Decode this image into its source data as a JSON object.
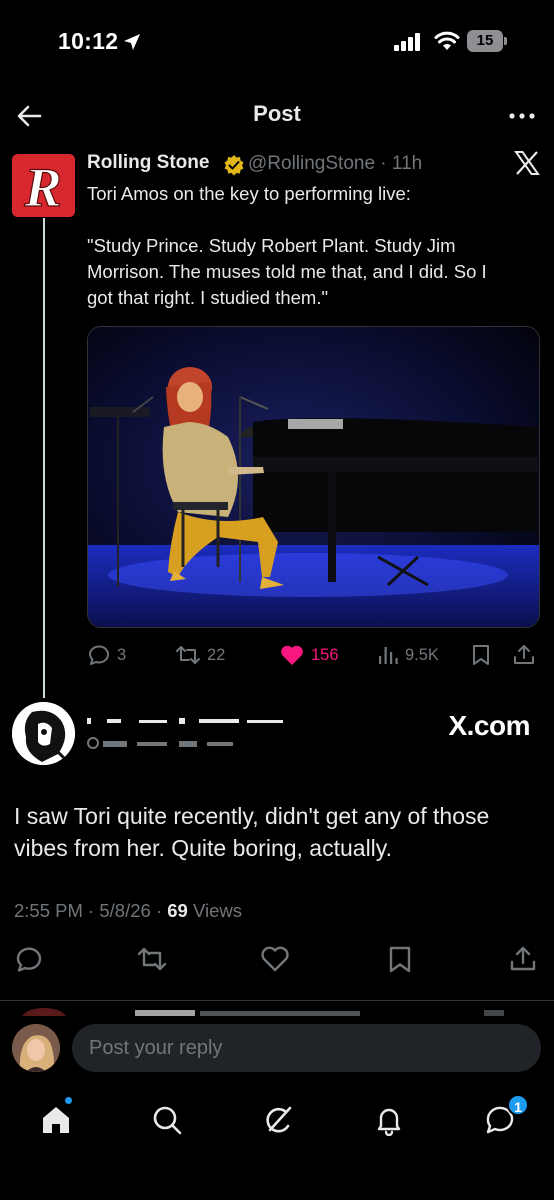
{
  "status_bar": {
    "time": "10:12",
    "battery": "15"
  },
  "header": {
    "title": "Post"
  },
  "quoted_post": {
    "author_name": "Rolling Stone",
    "handle": "@RollingStone",
    "time": "11h",
    "lines": [
      "Tori Amos on the key to performing live:",
      "",
      "\"Study Prince. Study Robert Plant. Study Jim",
      "Morrison. The muses told me that, and I did. So I",
      "got that right. I studied them.\""
    ],
    "stats": {
      "replies": "3",
      "reposts": "22",
      "likes": "156",
      "views": "9.5K"
    }
  },
  "reply_post": {
    "brand": "X.com",
    "text_lines": [
      "I saw Tori quite recently, didn't get any of those",
      "vibes from her. Quite boring, actually."
    ],
    "time": "2:55 PM",
    "date": "5/8/26",
    "views_count": "69",
    "views_label": "Views"
  },
  "compose": {
    "placeholder": "Post your reply"
  },
  "tabs": {
    "messages_badge": "1"
  },
  "colors": {
    "background": "#000000",
    "text": "#e7e9ea",
    "muted": "#71767b",
    "like": "#f91880",
    "accent": "#1d9bf0",
    "verified": "#e2b719",
    "rolling_stone_red": "#d7282f"
  }
}
